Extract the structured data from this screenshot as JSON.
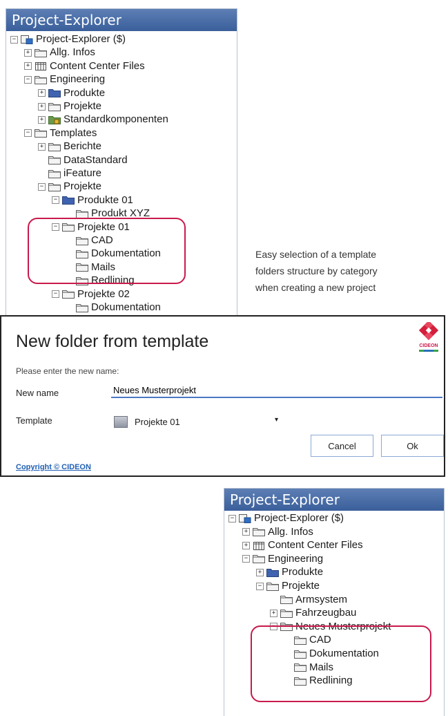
{
  "panel_top": {
    "title": "Project-Explorer",
    "items": [
      {
        "label": "Project-Explorer ($)",
        "icon": "project-explorer-icon"
      },
      {
        "label": "Allg. Infos",
        "icon": "folder-icon"
      },
      {
        "label": "Content Center Files",
        "icon": "library-icon"
      },
      {
        "label": "Engineering",
        "icon": "folder-icon"
      },
      {
        "label": "Produkte",
        "icon": "blue-folder-icon"
      },
      {
        "label": "Projekte",
        "icon": "folder-icon"
      },
      {
        "label": "Standardkomponenten",
        "icon": "locked-folder-icon"
      },
      {
        "label": "Templates",
        "icon": "folder-icon"
      },
      {
        "label": "Berichte",
        "icon": "folder-icon"
      },
      {
        "label": "DataStandard",
        "icon": "folder-icon"
      },
      {
        "label": "iFeature",
        "icon": "folder-icon"
      },
      {
        "label": "Projekte",
        "icon": "folder-icon"
      },
      {
        "label": "Produkte 01",
        "icon": "blue-folder-icon"
      },
      {
        "label": "Produkt XYZ",
        "icon": "folder-icon"
      },
      {
        "label": "Projekte 01",
        "icon": "folder-icon"
      },
      {
        "label": "CAD",
        "icon": "folder-icon"
      },
      {
        "label": "Dokumentation",
        "icon": "folder-icon"
      },
      {
        "label": "Mails",
        "icon": "folder-icon"
      },
      {
        "label": "Redlining",
        "icon": "folder-icon"
      },
      {
        "label": "Projekte 02",
        "icon": "folder-icon"
      },
      {
        "label": "Dokumentation",
        "icon": "folder-icon"
      }
    ]
  },
  "note": {
    "line1": "Easy selection of a template",
    "line2": "folders structure by category",
    "line3": "when creating a new project"
  },
  "dialog": {
    "title": "New folder from template",
    "logo_text": "CIDEON",
    "prompt": "Please enter the new name:",
    "name_label": "New name",
    "name_value": "Neues Musterprojekt",
    "template_label": "Template",
    "template_value": "Projekte 01",
    "cancel_label": "Cancel",
    "ok_label": "Ok",
    "copyright": "Copyright © CIDEON"
  },
  "panel_bottom": {
    "title": "Project-Explorer",
    "items": [
      {
        "label": "Project-Explorer ($)",
        "icon": "project-explorer-icon"
      },
      {
        "label": "Allg. Infos",
        "icon": "folder-icon"
      },
      {
        "label": "Content Center Files",
        "icon": "library-icon"
      },
      {
        "label": "Engineering",
        "icon": "folder-icon"
      },
      {
        "label": "Produkte",
        "icon": "blue-folder-icon"
      },
      {
        "label": "Projekte",
        "icon": "folder-icon"
      },
      {
        "label": "Armsystem",
        "icon": "folder-icon"
      },
      {
        "label": "Fahrzeugbau",
        "icon": "folder-icon"
      },
      {
        "label": "Neues Musterprojekt",
        "icon": "folder-icon"
      },
      {
        "label": "CAD",
        "icon": "folder-icon"
      },
      {
        "label": "Dokumentation",
        "icon": "folder-icon"
      },
      {
        "label": "Mails",
        "icon": "folder-icon"
      },
      {
        "label": "Redlining",
        "icon": "folder-icon"
      }
    ]
  },
  "colors": {
    "header": "#3a5f9a",
    "highlight": "#c8194b",
    "link": "#1f5fb4",
    "input_focus": "#4a78c2"
  }
}
